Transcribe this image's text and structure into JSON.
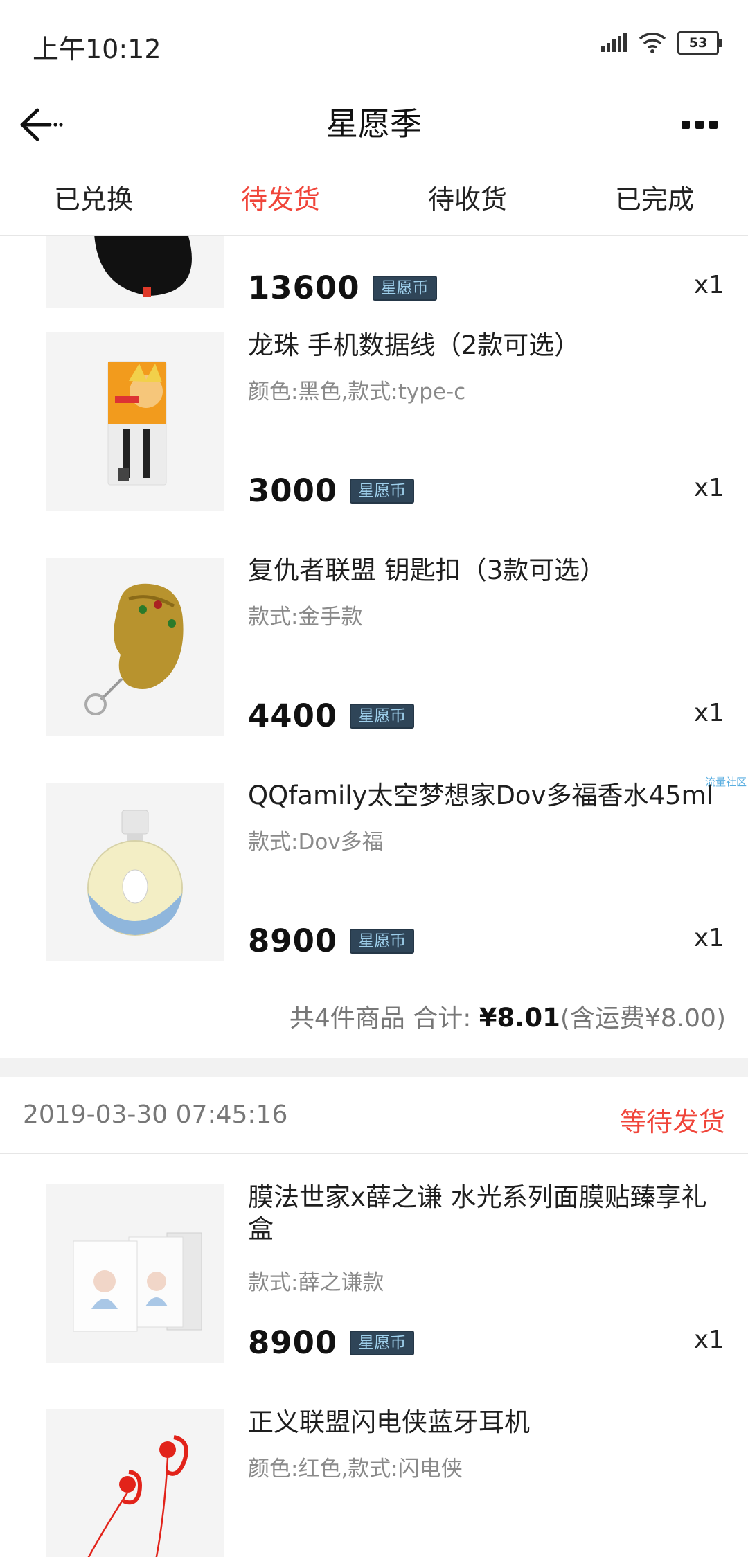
{
  "status_bar": {
    "time": "上午10:12",
    "battery": "53"
  },
  "nav": {
    "title": "星愿季"
  },
  "tabs": [
    {
      "label": "已兑换",
      "active": false
    },
    {
      "label": "待发货",
      "active": true
    },
    {
      "label": "待收货",
      "active": false
    },
    {
      "label": "已完成",
      "active": false
    }
  ],
  "currency_label": "星愿币",
  "order1": {
    "items": [
      {
        "name": "",
        "spec": "",
        "price": "13600",
        "qty": "x1"
      },
      {
        "name": "龙珠 手机数据线（2款可选）",
        "spec": "颜色:黑色,款式:type-c",
        "price": "3000",
        "qty": "x1"
      },
      {
        "name": "复仇者联盟 钥匙扣（3款可选）",
        "spec": "款式:金手款",
        "price": "4400",
        "qty": "x1"
      },
      {
        "name": "QQfamily太空梦想家Dov多福香水45ml",
        "spec": "款式:Dov多福",
        "price": "8900",
        "qty": "x1"
      }
    ],
    "summary": {
      "count_text": "共4件商品 合计: ",
      "total": "¥8.01",
      "shipping": "(含运费¥8.00)"
    }
  },
  "watermark": "流量社区",
  "order2": {
    "date": "2019-03-30 07:45:16",
    "status": "等待发货",
    "items": [
      {
        "name": "膜法世家x薛之谦 水光系列面膜贴臻享礼盒",
        "spec": "款式:薛之谦款",
        "price": "8900",
        "qty": "x1"
      },
      {
        "name": "正义联盟闪电侠蓝牙耳机",
        "spec": "颜色:红色,款式:闪电侠",
        "price": "",
        "qty": ""
      }
    ]
  },
  "colors": {
    "accent": "#f0453a",
    "badge_bg": "#2f4558",
    "badge_text": "#9fd0ec",
    "divider": "#f2f2f2"
  }
}
